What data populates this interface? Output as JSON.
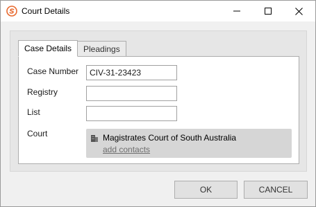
{
  "window": {
    "title": "Court Details",
    "icons": {
      "app": "app-logo-icon",
      "minimize": "minimize-icon",
      "maximize": "maximize-icon",
      "close": "close-icon"
    },
    "accent_color": "#e8692e"
  },
  "tabs": [
    {
      "label": "Case Details",
      "active": true
    },
    {
      "label": "Pleadings",
      "active": false
    }
  ],
  "form": {
    "case_number": {
      "label": "Case Number",
      "value": "CIV-31-23423"
    },
    "registry": {
      "label": "Registry",
      "value": ""
    },
    "list": {
      "label": "List",
      "value": ""
    },
    "court": {
      "label": "Court",
      "name": "Magistrates Court of South Australia",
      "icon": "building-icon",
      "link_label": "add contacts"
    }
  },
  "buttons": {
    "ok_label": "OK",
    "cancel_label": "CANCEL"
  }
}
